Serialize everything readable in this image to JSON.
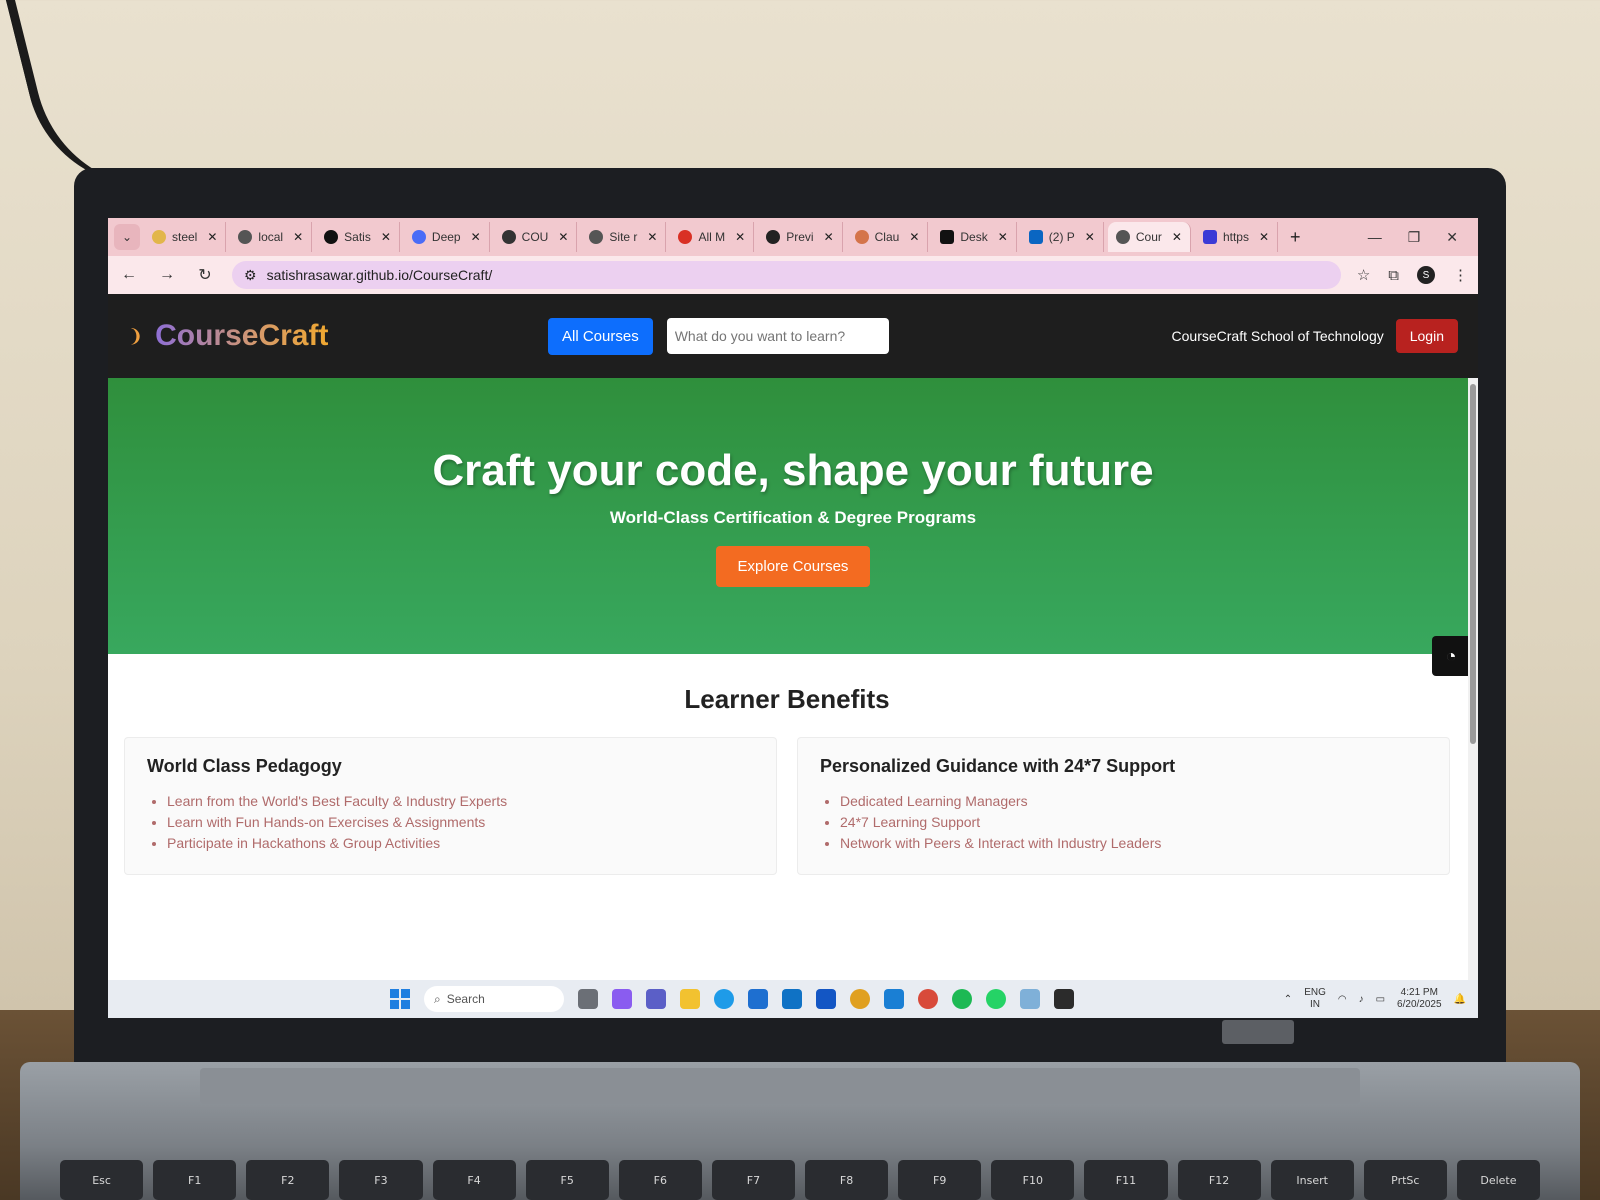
{
  "browser": {
    "tabs": [
      {
        "label": "steel",
        "active": false
      },
      {
        "label": "local",
        "active": false
      },
      {
        "label": "Satis",
        "active": false
      },
      {
        "label": "Deep",
        "active": false
      },
      {
        "label": "COU",
        "active": false
      },
      {
        "label": "Site r",
        "active": false
      },
      {
        "label": "All M",
        "active": false
      },
      {
        "label": "Previ",
        "active": false
      },
      {
        "label": "Clau",
        "active": false
      },
      {
        "label": "Desk",
        "active": false
      },
      {
        "label": "(2) P",
        "active": false
      },
      {
        "label": "Cour",
        "active": true
      },
      {
        "label": "https",
        "active": false
      }
    ],
    "url": "satishrasawar.github.io/CourseCraft/"
  },
  "navbar": {
    "brand": "CourseCraft",
    "all_courses_label": "All Courses",
    "search_placeholder": "What do you want to learn?",
    "school_link": "CourseCraft School of Technology",
    "login_label": "Login"
  },
  "hero": {
    "title": "Craft your code, shape your future",
    "subtitle": "World-Class Certification & Degree Programs",
    "cta_label": "Explore Courses"
  },
  "benefits": {
    "title": "Learner Benefits",
    "cards": [
      {
        "title": "World Class Pedagogy",
        "items": [
          "Learn from the World's Best Faculty & Industry Experts",
          "Learn with Fun Hands-on Exercises & Assignments",
          "Participate in Hackathons & Group Activities"
        ]
      },
      {
        "title": "Personalized Guidance with 24*7 Support",
        "items": [
          "Dedicated Learning Managers",
          "24*7 Learning Support",
          "Network with Peers & Interact with Industry Leaders"
        ]
      }
    ]
  },
  "taskbar": {
    "search_label": "Search",
    "lang_top": "ENG",
    "lang_bottom": "IN",
    "time": "4:21 PM",
    "date": "6/20/2025"
  },
  "colors": {
    "hero_green": "#38a85e",
    "nav_dark": "#1e1e1e",
    "primary_blue": "#0d6efd",
    "login_red": "#b8221f",
    "cta_orange": "#f36b21"
  },
  "keyboard": {
    "keys": [
      "Esc",
      "F1",
      "F2",
      "F3",
      "F4",
      "F5",
      "F6",
      "F7",
      "F8",
      "F9",
      "F10",
      "F11",
      "F12",
      "Insert",
      "PrtSc",
      "Delete"
    ]
  }
}
